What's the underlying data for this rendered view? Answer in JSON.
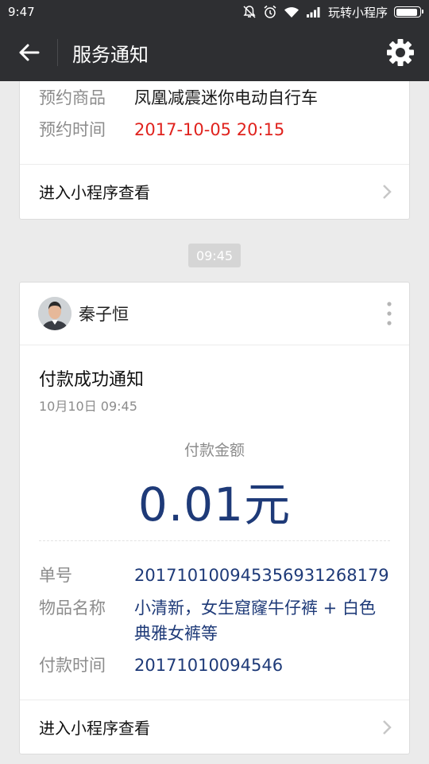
{
  "status_bar": {
    "time": "9:47",
    "carrier": "玩转小程序",
    "icons": [
      "mute-icon",
      "alarm-icon",
      "wifi-icon",
      "signal-icon",
      "battery-icon"
    ],
    "battery_level": 0.9
  },
  "nav": {
    "title": "服务通知",
    "back_icon": "arrow-left-icon",
    "settings_icon": "gear-icon"
  },
  "top_card": {
    "product_label": "预约商品",
    "product_value": "凤凰减震迷你电动自行车",
    "time_label": "预约时间",
    "time_value": "2017-10-05 20:15",
    "time_value_color": "#e0231e",
    "enter_label": "进入小程序查看"
  },
  "time_badge": "09:45",
  "main_card": {
    "sender_name": "秦子恒",
    "title": "付款成功通知",
    "date": "10月10日  09:45",
    "amount_label": "付款金额",
    "amount_value": "0.01元",
    "amount_color": "#1e3a78",
    "order_label": "单号",
    "order_value": "20171010094535693126817​9",
    "item_label": "物品名称",
    "item_value": "小清新，女生窟窿牛仔裤 + 白色典雅女裤等",
    "pay_time_label": "付款时间",
    "pay_time_value": "20171010094546",
    "enter_label": "进入小程序查看"
  }
}
